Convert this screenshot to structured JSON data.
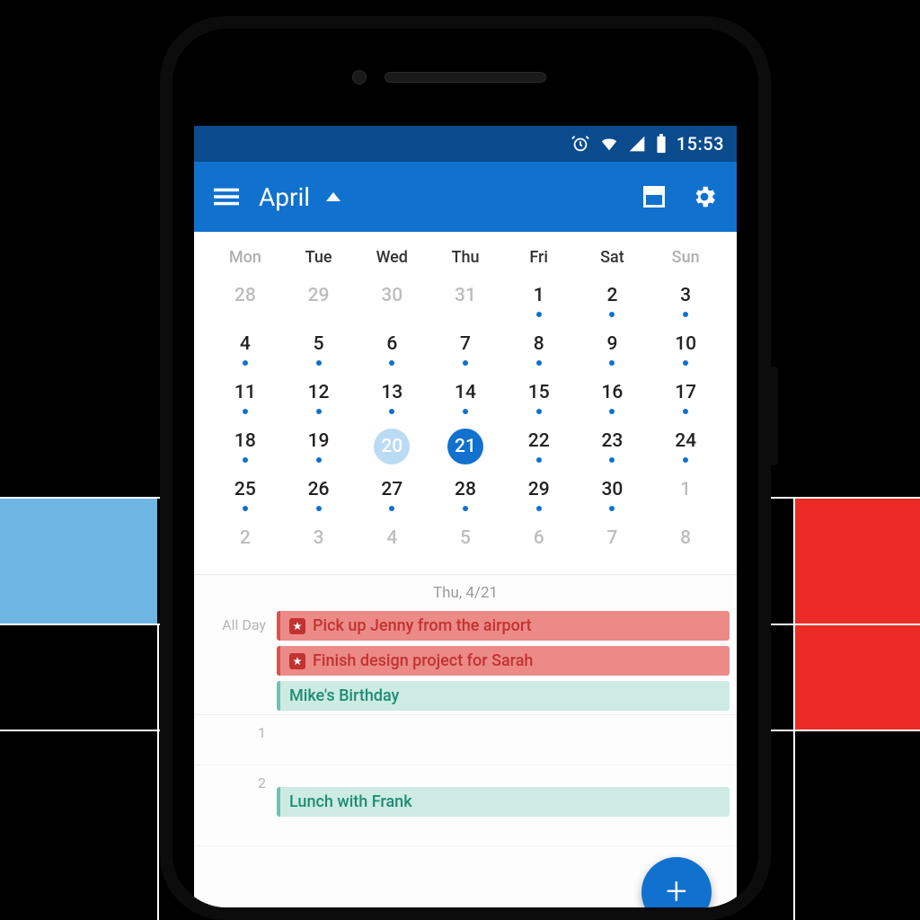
{
  "status_bar": {
    "time": "15:53"
  },
  "app_bar": {
    "title": "April"
  },
  "calendar": {
    "headers": [
      "Mon",
      "Tue",
      "Wed",
      "Thu",
      "Fri",
      "Sat",
      "Sun"
    ],
    "rows": [
      [
        {
          "n": "28",
          "dim": true
        },
        {
          "n": "29",
          "dim": true
        },
        {
          "n": "30",
          "dim": true
        },
        {
          "n": "31",
          "dim": true
        },
        {
          "n": "1",
          "dot": true
        },
        {
          "n": "2",
          "dot": true
        },
        {
          "n": "3",
          "dot": true
        }
      ],
      [
        {
          "n": "4",
          "dot": true
        },
        {
          "n": "5",
          "dot": true
        },
        {
          "n": "6",
          "dot": true
        },
        {
          "n": "7",
          "dot": true
        },
        {
          "n": "8",
          "dot": true
        },
        {
          "n": "9",
          "dot": true
        },
        {
          "n": "10",
          "dot": true
        }
      ],
      [
        {
          "n": "11",
          "dot": true
        },
        {
          "n": "12",
          "dot": true
        },
        {
          "n": "13",
          "dot": true
        },
        {
          "n": "14",
          "dot": true
        },
        {
          "n": "15",
          "dot": true
        },
        {
          "n": "16",
          "dot": true
        },
        {
          "n": "17",
          "dot": true
        }
      ],
      [
        {
          "n": "18",
          "dot": true
        },
        {
          "n": "19",
          "dot": true
        },
        {
          "n": "20",
          "today": true
        },
        {
          "n": "21",
          "selected": true
        },
        {
          "n": "22",
          "dot": true
        },
        {
          "n": "23",
          "dot": true
        },
        {
          "n": "24",
          "dot": true
        }
      ],
      [
        {
          "n": "25",
          "dot": true
        },
        {
          "n": "26",
          "dot": true
        },
        {
          "n": "27",
          "dot": true
        },
        {
          "n": "28",
          "dot": true
        },
        {
          "n": "29",
          "dot": true
        },
        {
          "n": "30",
          "dot": true
        },
        {
          "n": "1",
          "dim": true
        }
      ],
      [
        {
          "n": "2",
          "dim": true
        },
        {
          "n": "3",
          "dim": true
        },
        {
          "n": "4",
          "dim": true
        },
        {
          "n": "5",
          "dim": true
        },
        {
          "n": "6",
          "dim": true
        },
        {
          "n": "7",
          "dim": true
        },
        {
          "n": "8",
          "dim": true
        }
      ]
    ]
  },
  "agenda": {
    "date_label": "Thu, 4/21",
    "all_day_label": "All Day",
    "all_day_events": [
      {
        "text": "Pick up Jenny from the airport",
        "color": "red",
        "wl": true
      },
      {
        "text": "Finish design project for Sarah",
        "color": "red",
        "wl": true
      },
      {
        "text": "Mike's Birthday",
        "color": "teal",
        "wl": false
      }
    ],
    "hours": [
      {
        "label": "1",
        "events": []
      },
      {
        "label": "2",
        "events": [
          {
            "text": "Lunch with Frank",
            "color": "teal"
          }
        ]
      }
    ]
  },
  "colors": {
    "primary": "#1071ce",
    "red": "#ec2b27",
    "blue_block": "#6eb5e3"
  }
}
